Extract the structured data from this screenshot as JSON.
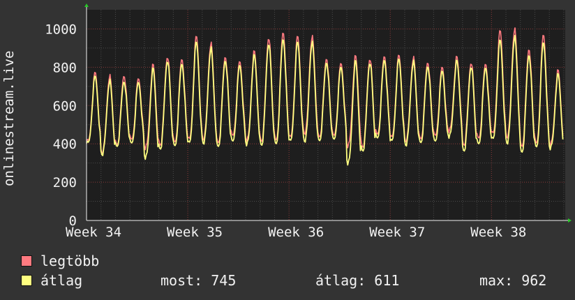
{
  "chart_data": {
    "type": "line",
    "ylabel": "onlinestream.live",
    "ylim": [
      0,
      1100
    ],
    "yticks": [
      0,
      200,
      400,
      600,
      800,
      1000
    ],
    "xlim": [
      0,
      33.1
    ],
    "xticks": [
      {
        "label": "Week 34",
        "x": 0
      },
      {
        "label": "Week 35",
        "x": 7
      },
      {
        "label": "Week 36",
        "x": 14
      },
      {
        "label": "Week 37",
        "x": 21
      },
      {
        "label": "Week 38",
        "x": 28
      }
    ],
    "grid": true,
    "background": "#1e1e1e",
    "series": [
      {
        "name": "legtöbb",
        "color": "#ff7a80",
        "daily_peaks": [
          770,
          755,
          760,
          740,
          810,
          860,
          845,
          960,
          925,
          860,
          830,
          880,
          960,
          985,
          960,
          960,
          850,
          820,
          855,
          850,
          860,
          860,
          850,
          830,
          800,
          850,
          830,
          820,
          990,
          1000,
          900,
          970,
          780
        ],
        "daily_troughs": [
          410,
          360,
          400,
          420,
          380,
          400,
          410,
          420,
          430,
          410,
          440,
          420,
          420,
          420,
          430,
          460,
          440,
          440,
          390,
          390,
          450,
          430,
          420,
          430,
          440,
          470,
          400,
          430,
          450,
          440,
          390,
          400
        ]
      },
      {
        "name": "átlag",
        "color": "#ffff80",
        "daily_peaks": [
          750,
          730,
          730,
          720,
          790,
          840,
          820,
          930,
          900,
          840,
          810,
          860,
          930,
          950,
          930,
          930,
          830,
          800,
          830,
          830,
          840,
          840,
          830,
          810,
          780,
          830,
          810,
          800,
          940,
          960,
          870,
          930,
          760
        ],
        "daily_troughs": [
          400,
          350,
          390,
          400,
          330,
          380,
          390,
          400,
          410,
          390,
          410,
          400,
          400,
          400,
          410,
          420,
          420,
          420,
          300,
          370,
          430,
          410,
          400,
          410,
          410,
          440,
          370,
          400,
          420,
          410,
          360,
          380
        ]
      }
    ]
  },
  "legend": {
    "max_label": "legtöbb",
    "avg_label": "átlag",
    "max_color": "#ff7a80",
    "avg_color": "#ffff80",
    "stats": {
      "now": "most: 745",
      "avg": "átlag: 611",
      "max": "max: 962"
    }
  }
}
